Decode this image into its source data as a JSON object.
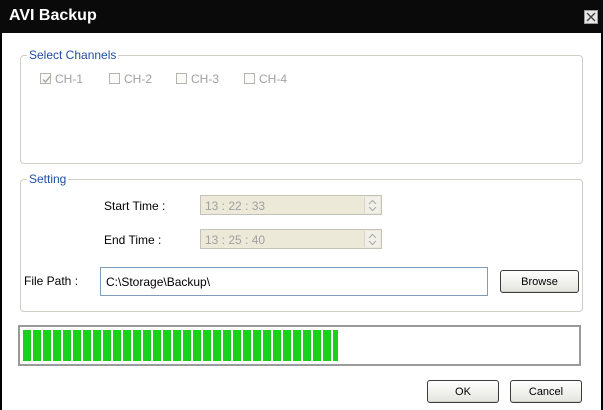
{
  "window": {
    "title": "AVI Backup"
  },
  "channels": {
    "legend": "Select Channels",
    "items": [
      {
        "label": "CH-1",
        "checked": true
      },
      {
        "label": "CH-2",
        "checked": false
      },
      {
        "label": "CH-3",
        "checked": false
      },
      {
        "label": "CH-4",
        "checked": false
      }
    ]
  },
  "setting": {
    "legend": "Setting",
    "start_time_label": "Start Time :",
    "start_time_value": "13 : 22 : 33",
    "end_time_label": "End Time :",
    "end_time_value": "13 : 25 : 40",
    "file_path_label": "File Path :",
    "file_path_value": "C:\\Storage\\Backup\\",
    "browse_label": "Browse"
  },
  "progress": {
    "fraction": 0.57
  },
  "buttons": {
    "ok_label": "OK",
    "cancel_label": "Cancel"
  },
  "colors": {
    "progress": "#19d119",
    "legend": "#1f4fa3",
    "titlebar": "#0a0a0a"
  }
}
